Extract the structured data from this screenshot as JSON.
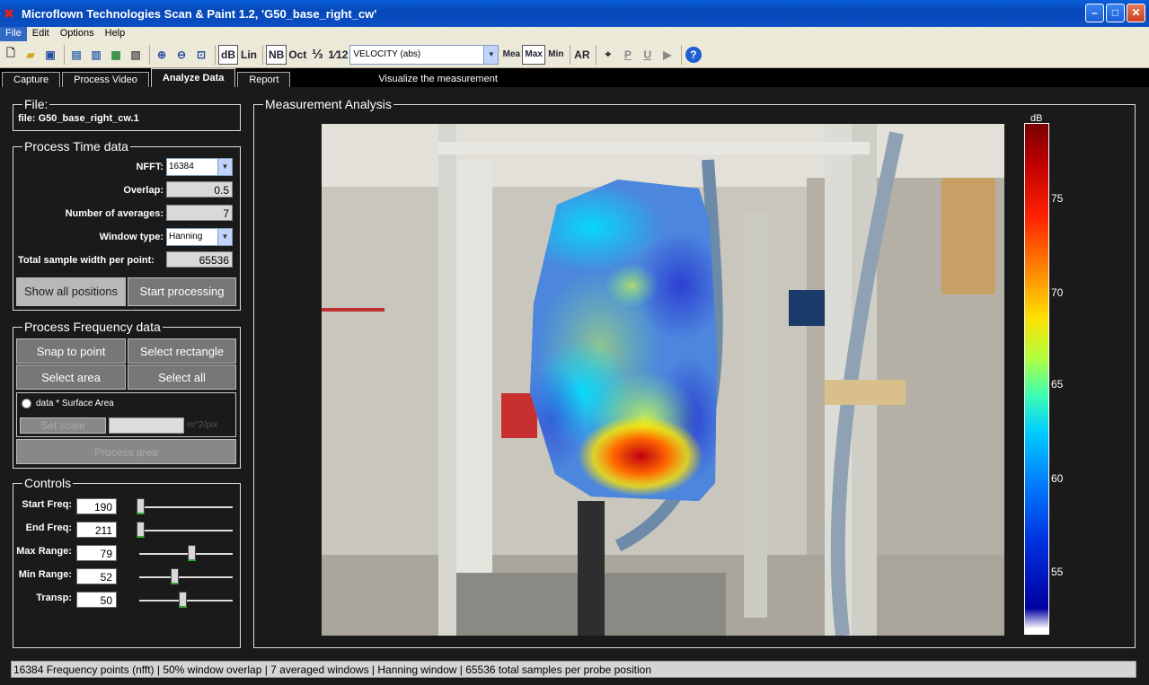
{
  "window": {
    "title": "Microflown Technologies Scan & Paint 1.2, 'G50_base_right_cw'"
  },
  "menu": [
    "File",
    "Edit",
    "Options",
    "Help"
  ],
  "toolbar": {
    "db": "dB",
    "lin": "Lin",
    "nb": "NB",
    "oct": "Oct",
    "third": "⅓",
    "twelfth": "1⁄12",
    "quantity": "VELOCITY (abs)",
    "mea": "Mea",
    "max": "Max",
    "min": "Min",
    "ar": "AR",
    "p": "P",
    "u": "U"
  },
  "tabs": [
    "Capture",
    "Process Video",
    "Analyze Data",
    "Report"
  ],
  "tab_hint": "Visualize the measurement",
  "file_group": {
    "legend": "File:",
    "file": "file: G50_base_right_cw.1"
  },
  "time_group": {
    "legend": "Process Time data",
    "nfft_label": "NFFT:",
    "nfft": "16384",
    "overlap_label": "Overlap:",
    "overlap": "0.5",
    "averages_label": "Number of averages:",
    "averages": "7",
    "window_label": "Window type:",
    "window": "Hanning",
    "width_label": "Total sample width per point:",
    "width": "65536",
    "show_all": "Show all positions",
    "start": "Start processing"
  },
  "freq_group": {
    "legend": "Process Frequency data",
    "snap": "Snap to point",
    "rect": "Select rectangle",
    "area": "Select area",
    "all": "Select all",
    "radio_label": "data * Surface Area",
    "set_scale": "Set scale",
    "unit": "m^2/pix",
    "process_area": "Process area"
  },
  "controls": {
    "legend": "Controls",
    "start_label": "Start Freq:",
    "start": "190",
    "start_level": 0.0,
    "end_label": "End Freq:",
    "end": "211",
    "end_level": 0.0,
    "maxr_label": "Max Range:",
    "maxr": "79",
    "maxr_level": 0.58,
    "minr_label": "Min Range:",
    "minr": "52",
    "minr_level": 0.39,
    "transp_label": "Transp:",
    "transp": "50",
    "transp_level": 0.48
  },
  "analysis": {
    "legend": "Measurement Analysis",
    "colorbar_title": "dB",
    "ticks": [
      "75",
      "70",
      "65",
      "60",
      "55"
    ]
  },
  "status": "16384 Frequency points (nfft)  |  50% window overlap  |  7 averaged windows  |  Hanning window  |  65536  total samples per probe position"
}
